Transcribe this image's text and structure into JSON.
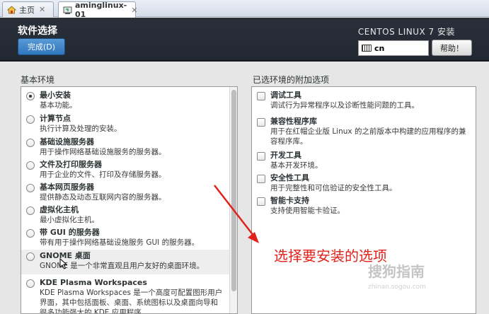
{
  "tabs": [
    {
      "label": "主页",
      "icon": "home-icon",
      "active": false
    },
    {
      "label": "aminglinux-01",
      "icon": "vm-icon",
      "active": true
    }
  ],
  "header": {
    "title": "软件选择",
    "done_label": "完成(D)",
    "product": "CENTOS LINUX 7 安装",
    "keyboard_layout": "cn",
    "help_label": "帮助！"
  },
  "base_env": {
    "title": "基本环境",
    "items": [
      {
        "name": "最小安装",
        "desc": "基本功能。",
        "checked": true
      },
      {
        "name": "计算节点",
        "desc": "执行计算及处理的安装。",
        "checked": false
      },
      {
        "name": "基础设施服务器",
        "desc": "用于操作网络基础设施服务的服务器。",
        "checked": false
      },
      {
        "name": "文件及打印服务器",
        "desc": "用于企业的文件、打印及存储服务器。",
        "checked": false
      },
      {
        "name": "基本网页服务器",
        "desc": "提供静态及动态互联网内容的服务器。",
        "checked": false
      },
      {
        "name": "虚拟化主机",
        "desc": "最小虚拟化主机。",
        "checked": false
      },
      {
        "name": "带 GUI 的服务器",
        "desc": "带有用于操作网络基础设施服务 GUI 的服务器。",
        "checked": false
      },
      {
        "name": "GNOME 桌面",
        "desc": "GNOME 是一个非常直观且用户友好的桌面环境。",
        "checked": false
      },
      {
        "name": "KDE Plasma Workspaces",
        "desc": "KDE Plasma Workspaces 是一个高度可配置图形用户界面，其中包括面板、桌面、系统图标以及桌面向导和很多功能强大的 KDE 应用程序。",
        "checked": false
      }
    ]
  },
  "addons": {
    "title": "已选环境的附加选项",
    "items": [
      {
        "name": "调试工具",
        "desc": "调试行为异常程序以及诊断性能问题的工具。"
      },
      {
        "name": "兼容性程序库",
        "desc": "用于在红帽企业版 Linux 的之前版本中构建的应用程序的兼容程序库。"
      },
      {
        "name": "开发工具",
        "desc": "基本开发环境。"
      },
      {
        "name": "安全性工具",
        "desc": "用于完整性和可信验证的安全性工具。"
      },
      {
        "name": "智能卡支持",
        "desc": "支持使用智能卡验证。"
      }
    ]
  },
  "annotation": "选择要安装的选项",
  "watermark": {
    "text": "搜狗指南",
    "url": "zhinan.sogou.com"
  },
  "colors": {
    "accent": "#2f76bd",
    "header_bg": "#262c35",
    "annotation": "#e0221b"
  }
}
